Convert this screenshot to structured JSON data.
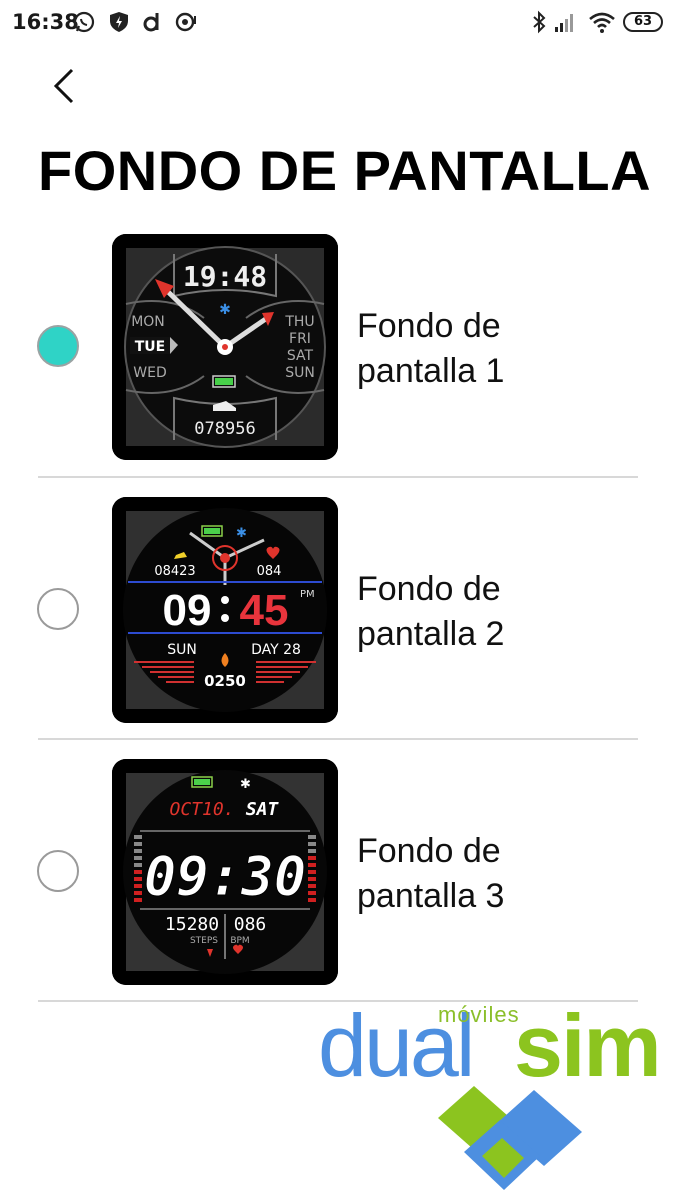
{
  "status_bar": {
    "time": "16:38",
    "left_icons": [
      "whatsapp-icon",
      "shield-icon",
      "d-app-icon",
      "camera-app-icon"
    ],
    "right_icons": [
      "bluetooth-icon",
      "signal-icon",
      "wifi-icon"
    ],
    "battery": "63"
  },
  "header": {
    "back_icon": "chevron-left-icon",
    "title": "FONDO DE PANTALLA"
  },
  "accent_color": "#2fd3c6",
  "items": [
    {
      "label": "Fondo de pantalla 1",
      "selected": true,
      "face": {
        "time": "19:48",
        "days_left": [
          "MON",
          "TUE",
          "WED"
        ],
        "days_right": [
          "THU",
          "FRI",
          "SAT",
          "SUN"
        ],
        "steps": "078956"
      }
    },
    {
      "label": "Fondo de pantalla 2",
      "selected": false,
      "face": {
        "steps": "08423",
        "heart": "084",
        "hour": "09",
        "minute": "45",
        "ampm": "PM",
        "day": "SUN",
        "date": "DAY 28",
        "calories": "0250"
      }
    },
    {
      "label": "Fondo de pantalla 3",
      "selected": false,
      "face": {
        "date": "OCT10.",
        "day": "SAT",
        "time": "09:30",
        "steps": "15280",
        "bpm": "086",
        "steps_label": "STEPS",
        "bpm_label": "BPM"
      }
    }
  ],
  "watermark": {
    "small": "móviles",
    "left": "dual",
    "right": "sim"
  }
}
